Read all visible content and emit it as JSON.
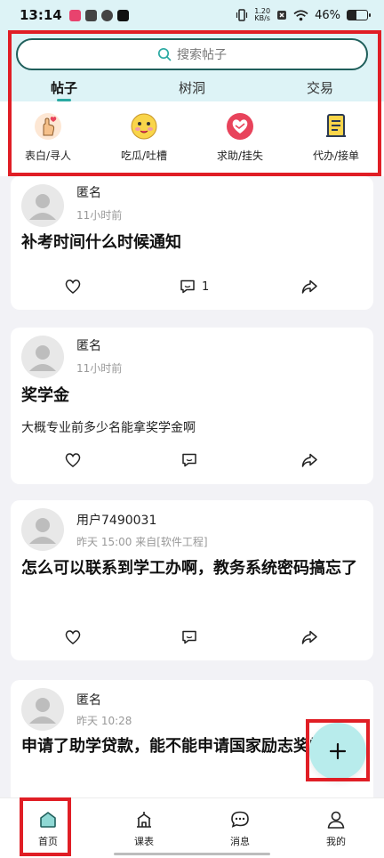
{
  "status_bar": {
    "time": "13:14",
    "net_speed_value": "1.20",
    "net_speed_unit": "KB/s",
    "battery": "46%",
    "battery_level_percent": 46
  },
  "search": {
    "placeholder": "搜索帖子"
  },
  "tabs": [
    {
      "label": "帖子",
      "active": true
    },
    {
      "label": "树洞",
      "active": false
    },
    {
      "label": "交易",
      "active": false
    }
  ],
  "categories": [
    {
      "label": "表白/寻人",
      "icon": "heart-hand-icon"
    },
    {
      "label": "吃瓜/吐槽",
      "icon": "emoji-face-icon"
    },
    {
      "label": "求助/挂失",
      "icon": "handshake-heart-icon"
    },
    {
      "label": "代办/接单",
      "icon": "document-icon"
    }
  ],
  "posts": [
    {
      "author": "匿名",
      "meta": "11小时前",
      "title": "补考时间什么时候通知",
      "body": "",
      "comment_count": "1"
    },
    {
      "author": "匿名",
      "meta": "11小时前",
      "title": "奖学金",
      "body": "大概专业前多少名能拿奖学金啊",
      "comment_count": ""
    },
    {
      "author": "用户7490031",
      "meta": "昨天 15:00  来自[软件工程]",
      "title": "怎么可以联系到学工办啊，教务系统密码搞忘了",
      "body": "",
      "comment_count": ""
    },
    {
      "author": "匿名",
      "meta": "昨天 10:28",
      "title": "申请了助学贷款，能不能申请国家励志奖学金？",
      "body": "",
      "comment_count": ""
    }
  ],
  "fab": {
    "label": "+"
  },
  "bottom_nav": [
    {
      "label": "首页",
      "icon": "home-icon",
      "active": true
    },
    {
      "label": "课表",
      "icon": "schedule-icon",
      "active": false
    },
    {
      "label": "消息",
      "icon": "message-icon",
      "active": false
    },
    {
      "label": "我的",
      "icon": "profile-icon",
      "active": false
    }
  ],
  "colors": {
    "header_bg": "#ddf3f6",
    "accent": "#2aa9a2",
    "annotation_red": "#e01e25"
  }
}
